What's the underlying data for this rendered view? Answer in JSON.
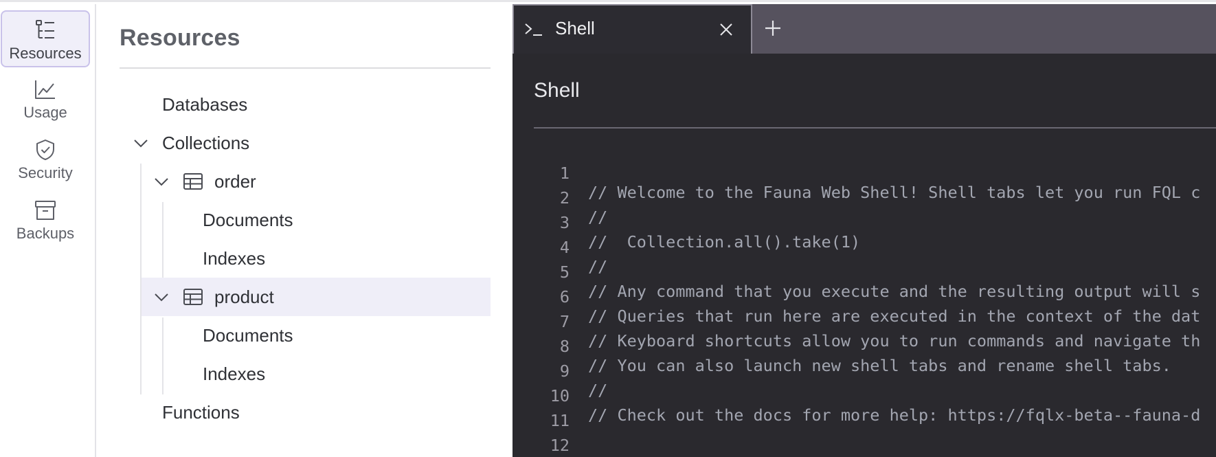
{
  "rail": {
    "items": [
      {
        "label": "Resources",
        "icon": "tree-list-icon",
        "active": true
      },
      {
        "label": "Usage",
        "icon": "chart-line-icon",
        "active": false
      },
      {
        "label": "Security",
        "icon": "shield-check-icon",
        "active": false
      },
      {
        "label": "Backups",
        "icon": "archive-box-icon",
        "active": false
      }
    ]
  },
  "resources": {
    "title": "Resources",
    "tree": {
      "databases": "Databases",
      "collections": "Collections",
      "order": {
        "label": "order",
        "documents": "Documents",
        "indexes": "Indexes"
      },
      "product": {
        "label": "product",
        "documents": "Documents",
        "indexes": "Indexes"
      },
      "functions": "Functions"
    }
  },
  "shell": {
    "tab_label": "Shell",
    "tab_prompt_glyph": ">_",
    "title": "Shell",
    "lines": [
      {
        "num": "1",
        "text": "// Welcome to the Fauna Web Shell! Shell tabs let you run FQL c"
      },
      {
        "num": "2",
        "text": "//"
      },
      {
        "num": "3",
        "text": "//  Collection.all().take(1)"
      },
      {
        "num": "4",
        "text": "//"
      },
      {
        "num": "5",
        "text": "// Any command that you execute and the resulting output will s"
      },
      {
        "num": "6",
        "text": "// Queries that run here are executed in the context of the dat"
      },
      {
        "num": "7",
        "text": "// Keyboard shortcuts allow you to run commands and navigate th"
      },
      {
        "num": "8",
        "text": "// You can also launch new shell tabs and rename shell tabs."
      },
      {
        "num": "9",
        "text": "//"
      },
      {
        "num": "10",
        "text": "// Check out the docs for more help: https://fqlx-beta--fauna-d"
      },
      {
        "num": "11",
        "text": ""
      },
      {
        "num": "12",
        "text": ""
      }
    ]
  },
  "colors": {
    "accent": "#c9c2ea",
    "selected_row": "#efeef8",
    "shell_bg": "#2a292e",
    "tabbar_bg": "#56525e"
  }
}
